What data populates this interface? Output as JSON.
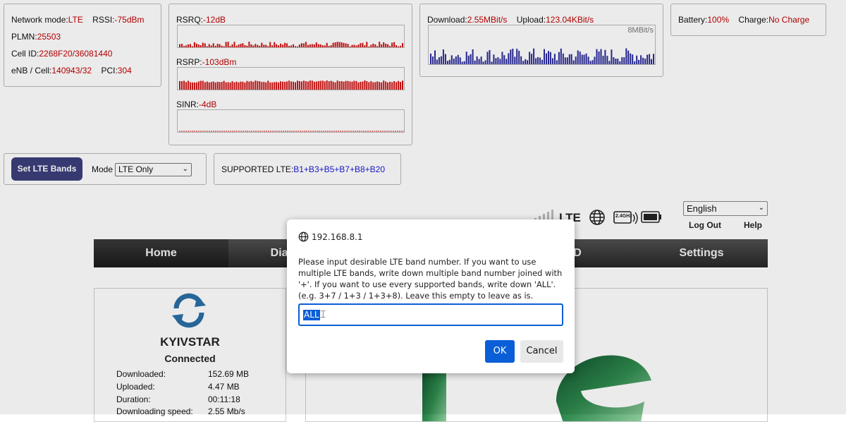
{
  "signal": {
    "network_mode_label": "Network mode:",
    "network_mode": "LTE",
    "rssi_label": "RSSI:",
    "rssi": "-75dBm",
    "plmn_label": "PLMN:",
    "plmn": "25503",
    "cell_id_label": "Cell ID:",
    "cell_id": "2268F20/36081440",
    "enb_label": "eNB / Cell:",
    "enb": "140943/32",
    "pci_label": "PCI:",
    "pci": "304"
  },
  "quality": {
    "rsrq_label": "RSRQ:",
    "rsrq": "-12dB",
    "rsrp_label": "RSRP:",
    "rsrp": "-103dBm",
    "sinr_label": "SINR:",
    "sinr": "-4dB"
  },
  "speed": {
    "download_label": "Download:",
    "download": "2.55MBit/s",
    "upload_label": "Upload:",
    "upload": "123.04KBit/s",
    "scale": "8MBit/s"
  },
  "battery": {
    "battery_label": "Battery:",
    "battery": "100%",
    "charge_label": "Charge:",
    "charge": "No Charge"
  },
  "controls": {
    "set_bands": "Set LTE Bands",
    "mode_label": "Mode",
    "mode_value": "LTE Only",
    "supported_label": "SUPPORTED LTE:",
    "supported_bands": "B1+B3+B5+B7+B8+B20"
  },
  "header": {
    "status_network": "LTE",
    "wifi_badge": "2.4GHz",
    "language": "English",
    "logout": "Log Out",
    "help": "Help"
  },
  "nav": {
    "home": "Home",
    "diag": "Diag",
    "d": "D",
    "settings": "Settings"
  },
  "connection": {
    "operator": "KYIVSTAR",
    "status": "Connected",
    "rows": [
      {
        "label": "Downloaded:",
        "value": "152.69 MB"
      },
      {
        "label": "Uploaded:",
        "value": "4.47 MB"
      },
      {
        "label": "Duration:",
        "value": "00:11:18"
      },
      {
        "label": "Downloading speed:",
        "value": "2.55 Mb/s"
      }
    ]
  },
  "dialog": {
    "host": "192.168.8.1",
    "message": "Please input desirable LTE band number. If you want to use multiple LTE bands, write down multiple band number joined with '+'. If you want to use every supported bands, write down 'ALL'. (e.g. 3+7 / 1+3 / 1+3+8). Leave this empty to leave as is.",
    "input_value": "ALL",
    "ok": "OK",
    "cancel": "Cancel"
  },
  "colors": {
    "value_red": "#c00000",
    "band_blue": "#1a1adb",
    "graph_red": "#d01010",
    "graph_blue": "#2a2a9a",
    "dialog_blue": "#0a5ed7"
  }
}
